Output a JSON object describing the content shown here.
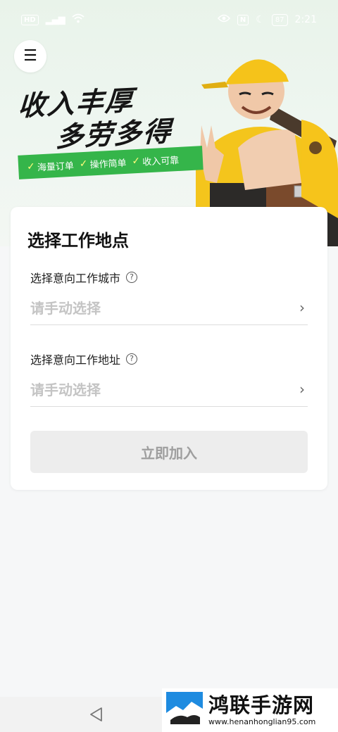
{
  "status_bar": {
    "left_chips": [
      "HD",
      "5G"
    ],
    "time": "2:21",
    "battery": "87"
  },
  "hero": {
    "menu_icon": "menu-icon",
    "slogan_line1": "收入丰厚",
    "slogan_line2": "多劳多得",
    "tags": [
      "海量订单",
      "操作简单",
      "收入可靠"
    ],
    "accent_color": "#35b54a"
  },
  "form": {
    "title": "选择工作地点",
    "city_label": "选择意向工作城市",
    "city_placeholder": "请手动选择",
    "address_label": "选择意向工作地址",
    "address_placeholder": "请手动选择",
    "help_icon_glyph": "?",
    "chevron_glyph": "›",
    "submit_label": "立即加入"
  },
  "watermark": {
    "name": "鸿联手游网",
    "url": "www.henanhonglian95.com"
  }
}
